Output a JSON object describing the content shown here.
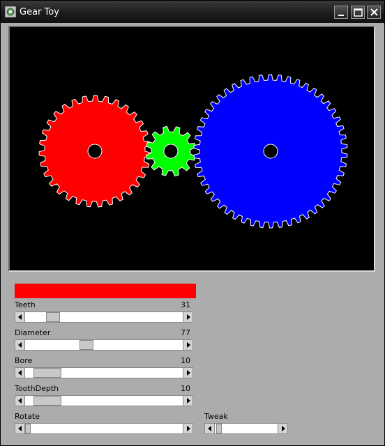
{
  "window": {
    "title": "Gear Toy"
  },
  "icons": {
    "app": "gear-app-icon",
    "minimize": "minimize-icon",
    "maximize": "maximize-icon",
    "close": "close-icon"
  },
  "gears": [
    {
      "color": "#ff0000",
      "teeth": 31
    },
    {
      "color": "#00ff00",
      "teeth": 12
    },
    {
      "color": "#0000ff",
      "teeth": 50
    }
  ],
  "selected_color": "#ff0000",
  "controls": [
    {
      "label": "Teeth",
      "value": "31"
    },
    {
      "label": "Diameter",
      "value": "77"
    },
    {
      "label": "Bore",
      "value": "10"
    },
    {
      "label": "ToothDepth",
      "value": "10"
    },
    {
      "label": "Rotate",
      "value": ""
    },
    {
      "label": "Tweak",
      "value": ""
    }
  ]
}
